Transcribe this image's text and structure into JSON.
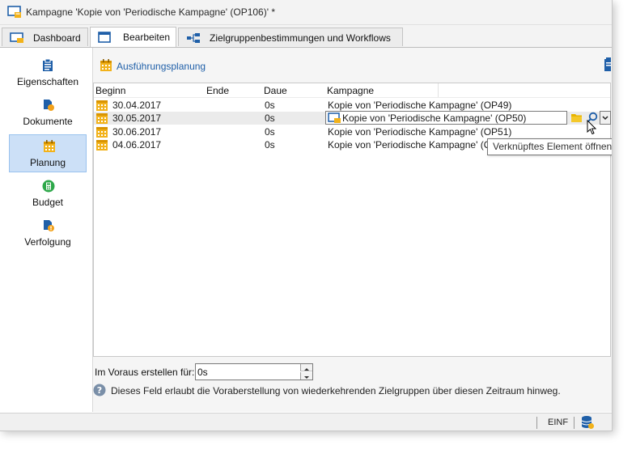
{
  "window": {
    "title": "Kampagne 'Kopie von 'Periodische Kampagne' (OP106)' *"
  },
  "tabs": [
    {
      "label": "Dashboard",
      "icon": "monitor-icon",
      "active": false
    },
    {
      "label": "Bearbeiten",
      "icon": "window-icon",
      "active": true
    },
    {
      "label": "Zielgruppenbestimmungen und Workflows",
      "icon": "workflow-icon",
      "active": false
    }
  ],
  "sidebar": {
    "items": [
      {
        "label": "Eigenschaften",
        "icon": "clipboard-icon",
        "active": false
      },
      {
        "label": "Dokumente",
        "icon": "documents-icon",
        "active": false
      },
      {
        "label": "Planung",
        "icon": "calendar-icon",
        "active": true
      },
      {
        "label": "Budget",
        "icon": "calculator-icon",
        "active": false
      },
      {
        "label": "Verfolgung",
        "icon": "tracking-icon",
        "active": false
      }
    ]
  },
  "section": {
    "title": "Ausführungsplanung"
  },
  "grid": {
    "columns": [
      "Beginn",
      "Ende",
      "Daue",
      "Kampagne"
    ],
    "rows": [
      {
        "beginn": "30.04.2017",
        "ende": "",
        "dauer": "0s",
        "kampagne": "Kopie von 'Periodische Kampagne' (OP49)"
      },
      {
        "beginn": "30.05.2017",
        "ende": "",
        "dauer": "0s",
        "kampagne": "Kopie von 'Periodische Kampagne' (OP50)"
      },
      {
        "beginn": "30.06.2017",
        "ende": "",
        "dauer": "0s",
        "kampagne": "Kopie von 'Periodische Kampagne' (OP51)"
      },
      {
        "beginn": "04.06.2017",
        "ende": "",
        "dauer": "0s",
        "kampagne": "Kopie von 'Periodische Kampagne' (O"
      }
    ],
    "selected_row": 1
  },
  "tooltip": {
    "text": "Verknüpftes Element öffnen"
  },
  "advance": {
    "label": "Im Voraus erstellen für:",
    "value": "0s"
  },
  "info": {
    "text": "Dieses Feld erlaubt die Voraberstellung von wiederkehrenden Zielgruppen über diesen Zeitraum hinweg."
  },
  "status": {
    "mode": "EINF"
  },
  "colors": {
    "accent": "#1f5fa8",
    "sidebar_active": "#cce0f7",
    "calendar": "#f2b21a"
  }
}
